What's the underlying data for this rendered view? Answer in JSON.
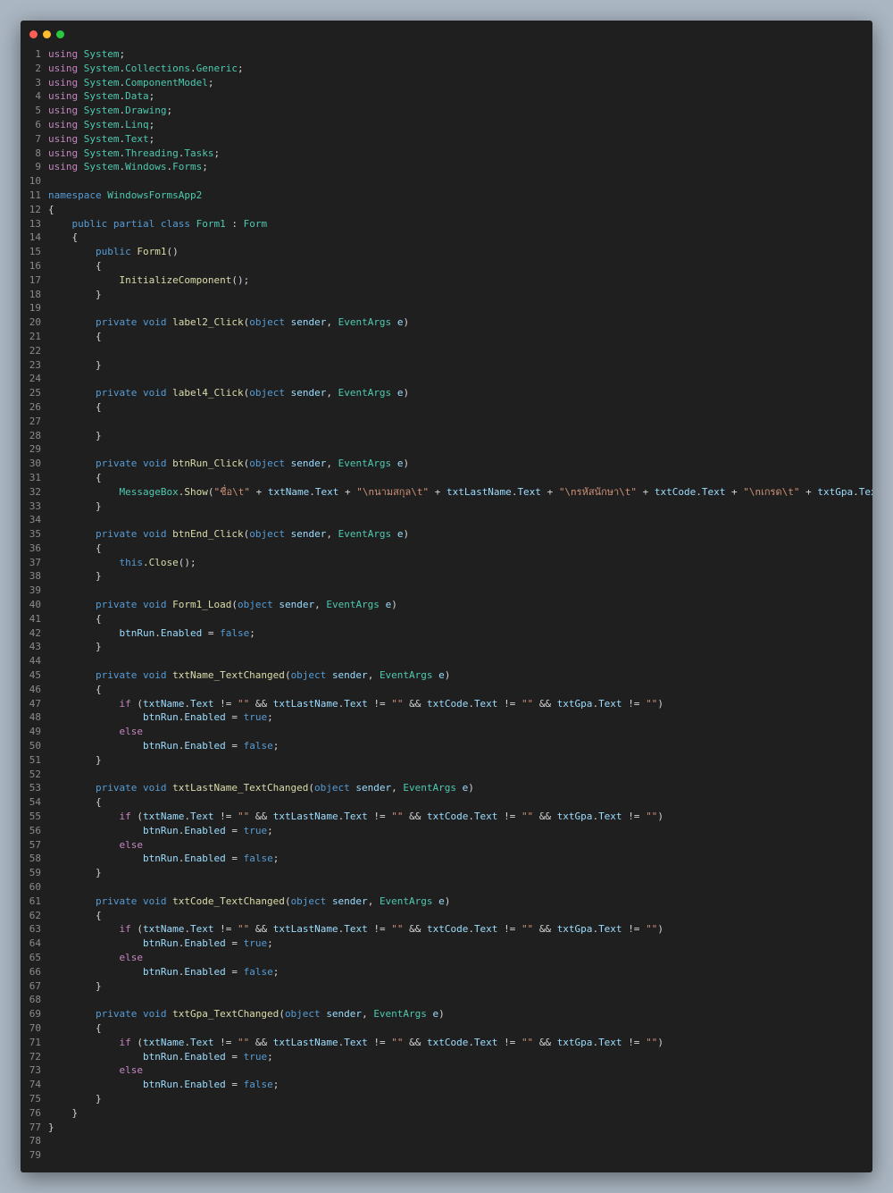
{
  "window": {
    "controls": [
      "close",
      "minimize",
      "maximize"
    ]
  },
  "editor": {
    "language": "csharp",
    "lines": [
      "using System;",
      "using System.Collections.Generic;",
      "using System.ComponentModel;",
      "using System.Data;",
      "using System.Drawing;",
      "using System.Linq;",
      "using System.Text;",
      "using System.Threading.Tasks;",
      "using System.Windows.Forms;",
      "",
      "namespace WindowsFormsApp2",
      "{",
      "    public partial class Form1 : Form",
      "    {",
      "        public Form1()",
      "        {",
      "            InitializeComponent();",
      "        }",
      "",
      "        private void label2_Click(object sender, EventArgs e)",
      "        {",
      "",
      "        }",
      "",
      "        private void label4_Click(object sender, EventArgs e)",
      "        {",
      "",
      "        }",
      "",
      "        private void btnRun_Click(object sender, EventArgs e)",
      "        {",
      "            MessageBox.Show(\"ชื่อ\\t\" + txtName.Text + \"\\nนามสกุล\\t\" + txtLastName.Text + \"\\nรหัสนักษา\\t\" + txtCode.Text + \"\\nเกรด\\t\" + txtGpa.Text);",
      "        }",
      "",
      "        private void btnEnd_Click(object sender, EventArgs e)",
      "        {",
      "            this.Close();",
      "        }",
      "",
      "        private void Form1_Load(object sender, EventArgs e)",
      "        {",
      "            btnRun.Enabled = false;",
      "        }",
      "",
      "        private void txtName_TextChanged(object sender, EventArgs e)",
      "        {",
      "            if (txtName.Text != \"\" && txtLastName.Text != \"\" && txtCode.Text != \"\" && txtGpa.Text != \"\")",
      "                btnRun.Enabled = true;",
      "            else",
      "                btnRun.Enabled = false;",
      "        }",
      "",
      "        private void txtLastName_TextChanged(object sender, EventArgs e)",
      "        {",
      "            if (txtName.Text != \"\" && txtLastName.Text != \"\" && txtCode.Text != \"\" && txtGpa.Text != \"\")",
      "                btnRun.Enabled = true;",
      "            else",
      "                btnRun.Enabled = false;",
      "        }",
      "",
      "        private void txtCode_TextChanged(object sender, EventArgs e)",
      "        {",
      "            if (txtName.Text != \"\" && txtLastName.Text != \"\" && txtCode.Text != \"\" && txtGpa.Text != \"\")",
      "                btnRun.Enabled = true;",
      "            else",
      "                btnRun.Enabled = false;",
      "        }",
      "",
      "        private void txtGpa_TextChanged(object sender, EventArgs e)",
      "        {",
      "            if (txtName.Text != \"\" && txtLastName.Text != \"\" && txtCode.Text != \"\" && txtGpa.Text != \"\")",
      "                btnRun.Enabled = true;",
      "            else",
      "                btnRun.Enabled = false;",
      "        }",
      "    }",
      "}",
      "",
      ""
    ]
  },
  "colors": {
    "background": "#1f1f1f",
    "page": "#aab6c2",
    "keyword_control": "#c586c0",
    "keyword": "#569cd6",
    "type": "#4ec9b0",
    "function": "#dcdcaa",
    "variable": "#9cdcfe",
    "string": "#ce9178",
    "line_number": "#8b8b8b"
  }
}
